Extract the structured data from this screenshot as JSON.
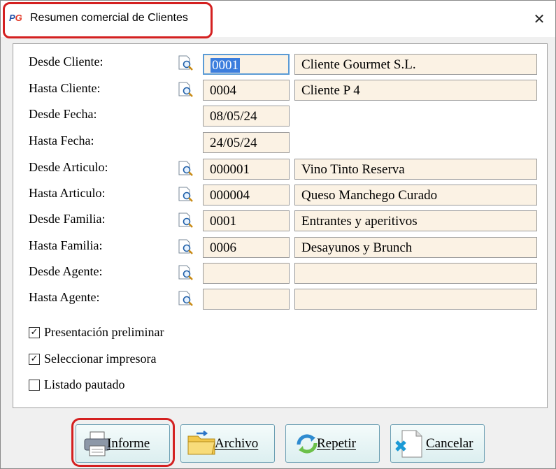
{
  "window": {
    "title": "Resumen comercial de Clientes",
    "app_icon_p": "P",
    "app_icon_g": "G",
    "close_glyph": "✕"
  },
  "accent_colors": {
    "highlight_red": "#d42020",
    "field_bg": "#fbf2e4",
    "selection_blue": "#3b7ddd"
  },
  "rows": [
    {
      "label": "Desde Cliente:",
      "lookup_icon": "lookup-icon",
      "code": "0001",
      "desc": "Cliente Gourmet S.L."
    },
    {
      "label": "Hasta Cliente:",
      "lookup_icon": "lookup-icon",
      "code": "0004",
      "desc": "Cliente P 4"
    },
    {
      "label": "Desde Fecha:",
      "code": "08/05/24"
    },
    {
      "label": "Hasta Fecha:",
      "code": "24/05/24"
    },
    {
      "label": "Desde Articulo:",
      "lookup_icon": "lookup-icon",
      "code": "000001",
      "desc": "Vino Tinto Reserva"
    },
    {
      "label": "Hasta Articulo:",
      "lookup_icon": "lookup-icon",
      "code": "000004",
      "desc": "Queso Manchego Curado"
    },
    {
      "label": "Desde Familia:",
      "lookup_icon": "lookup-icon",
      "code": "0001",
      "desc": "Entrantes y aperitivos"
    },
    {
      "label": "Hasta Familia:",
      "lookup_icon": "lookup-icon",
      "code": "0006",
      "desc": "Desayunos y Brunch"
    },
    {
      "label": "Desde Agente:",
      "lookup_icon": "lookup-icon",
      "code": "",
      "desc": ""
    },
    {
      "label": "Hasta Agente:",
      "lookup_icon": "lookup-icon",
      "code": "",
      "desc": ""
    }
  ],
  "options": [
    {
      "label": "Presentación preliminar",
      "checked": true,
      "mark": "✓"
    },
    {
      "label": "Seleccionar impresora",
      "checked": true,
      "mark": "✓"
    },
    {
      "label": "Listado pautado",
      "checked": false,
      "mark": ""
    }
  ],
  "buttons": [
    {
      "label": "Informe",
      "icon": "printer-icon"
    },
    {
      "label": "Archivo",
      "icon": "folder-icon"
    },
    {
      "label": "Repetir",
      "icon": "refresh-icon"
    },
    {
      "label": "Cancelar",
      "icon": "cancel-icon"
    }
  ]
}
